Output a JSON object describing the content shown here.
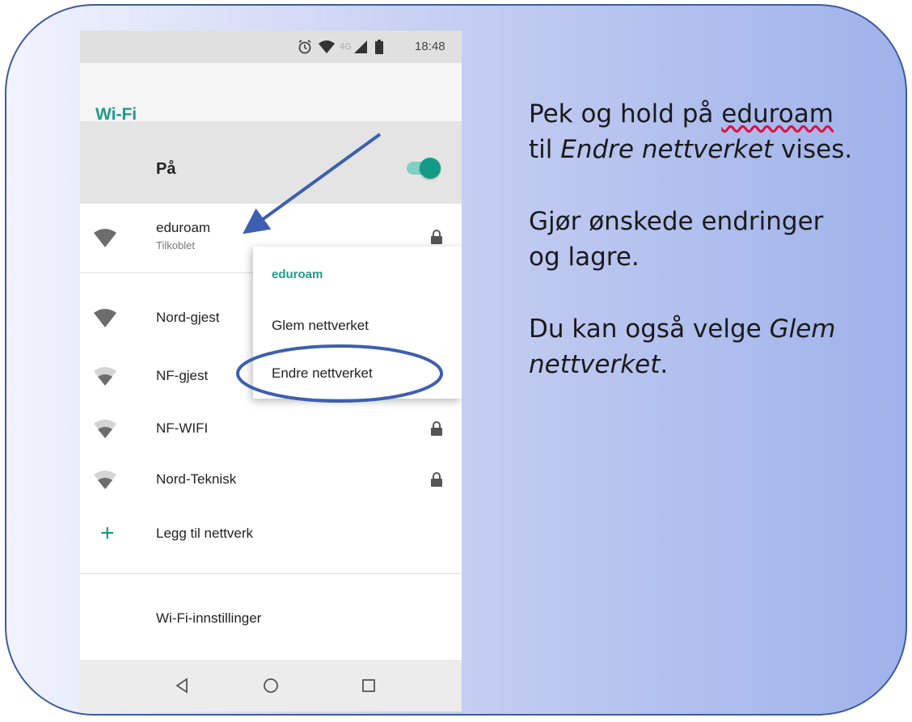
{
  "status_bar": {
    "network_label": "4G",
    "time": "18:48",
    "icons": [
      "alarm-icon",
      "wifi-signal-icon",
      "cell-signal-icon",
      "battery-icon"
    ]
  },
  "app_bar": {
    "title": "Wi-Fi"
  },
  "master_switch": {
    "label": "På",
    "state": "on"
  },
  "networks": [
    {
      "name": "eduroam",
      "status": "Tilkoblet",
      "secured": true,
      "signal": "strong"
    },
    {
      "name": "Nord-gjest",
      "status": "",
      "secured": false,
      "signal": "strong"
    },
    {
      "name": "NF-gjest",
      "status": "",
      "secured": false,
      "signal": "weak"
    },
    {
      "name": "NF-WIFI",
      "status": "",
      "secured": true,
      "signal": "weak"
    },
    {
      "name": "Nord-Teknisk",
      "status": "",
      "secured": true,
      "signal": "weak"
    }
  ],
  "add_network": {
    "label": "Legg til nettverk"
  },
  "settings": {
    "label": "Wi-Fi-innstillinger"
  },
  "context_menu": {
    "title": "eduroam",
    "items": [
      "Glem nettverket",
      "Endre nettverket"
    ]
  },
  "nav_bar": {
    "buttons": [
      "back-icon",
      "home-icon",
      "recents-icon"
    ]
  },
  "instructions": {
    "p1_line1_pre": "Pek og hold på ",
    "p1_line1_link": "eduroam",
    "p1_line2_pre": "til ",
    "p1_line2_em": "Endre nettverket",
    "p1_line2_post": " vises.",
    "p2_line1": "Gjør ønskede endringer",
    "p2_line2": "og lagre.",
    "p3_line1_pre": "Du kan også velge ",
    "p3_line1_em": "Glem",
    "p3_line2_em": "nettverket",
    "p3_line2_post": "."
  },
  "colors": {
    "accent": "#139a86",
    "annotation": "#3d5fb0",
    "card_border": "#3f5b9c"
  }
}
